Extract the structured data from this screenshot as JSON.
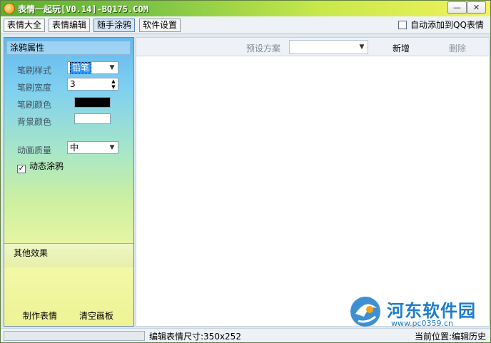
{
  "window": {
    "title": "表情一起玩[V0.14]-BQ175.COM",
    "minimize_label": "—",
    "close_label": "✕"
  },
  "menu": {
    "items": [
      {
        "label": "表情大全",
        "active": false
      },
      {
        "label": "表情编辑",
        "active": false
      },
      {
        "label": "随手涂鸦",
        "active": true
      },
      {
        "label": "软件设置",
        "active": false
      }
    ],
    "qq_checkbox_label": "自动添加到QQ表情",
    "qq_checkbox_checked": false
  },
  "sidebar": {
    "panel_title": "涂鸦属性",
    "brush_style_label": "笔刷样式",
    "brush_style_value": "铅笔",
    "brush_width_label": "笔刷宽度",
    "brush_width_value": "3",
    "brush_color_label": "笔刷颜色",
    "brush_color": "#000000",
    "bg_color_label": "背景颜色",
    "bg_color": "#ffffff",
    "anim_quality_label": "动画质量",
    "anim_quality_value": "中",
    "dynamic_label": "动态涂鸦",
    "dynamic_checked": true,
    "other_effects_label": "其他效果",
    "make_button": "制作表情",
    "clear_button": "清空画板"
  },
  "toolbar": {
    "preset_label": "预设方案",
    "preset_value": "",
    "new_button": "新增",
    "delete_button": "删除"
  },
  "status": {
    "size": "编辑表情尺寸:350x252",
    "location": "当前位置:编辑历史"
  },
  "watermark": {
    "name": "河东软件园",
    "url": "www.pc0359.cn"
  },
  "colors": {
    "title_gradient_start": "#5fae2e",
    "title_gradient_end": "#f2f25e",
    "sidebar_top": "#64b8ee",
    "sidebar_bottom": "#e6f5a4",
    "watermark": "#1d7ccb"
  }
}
